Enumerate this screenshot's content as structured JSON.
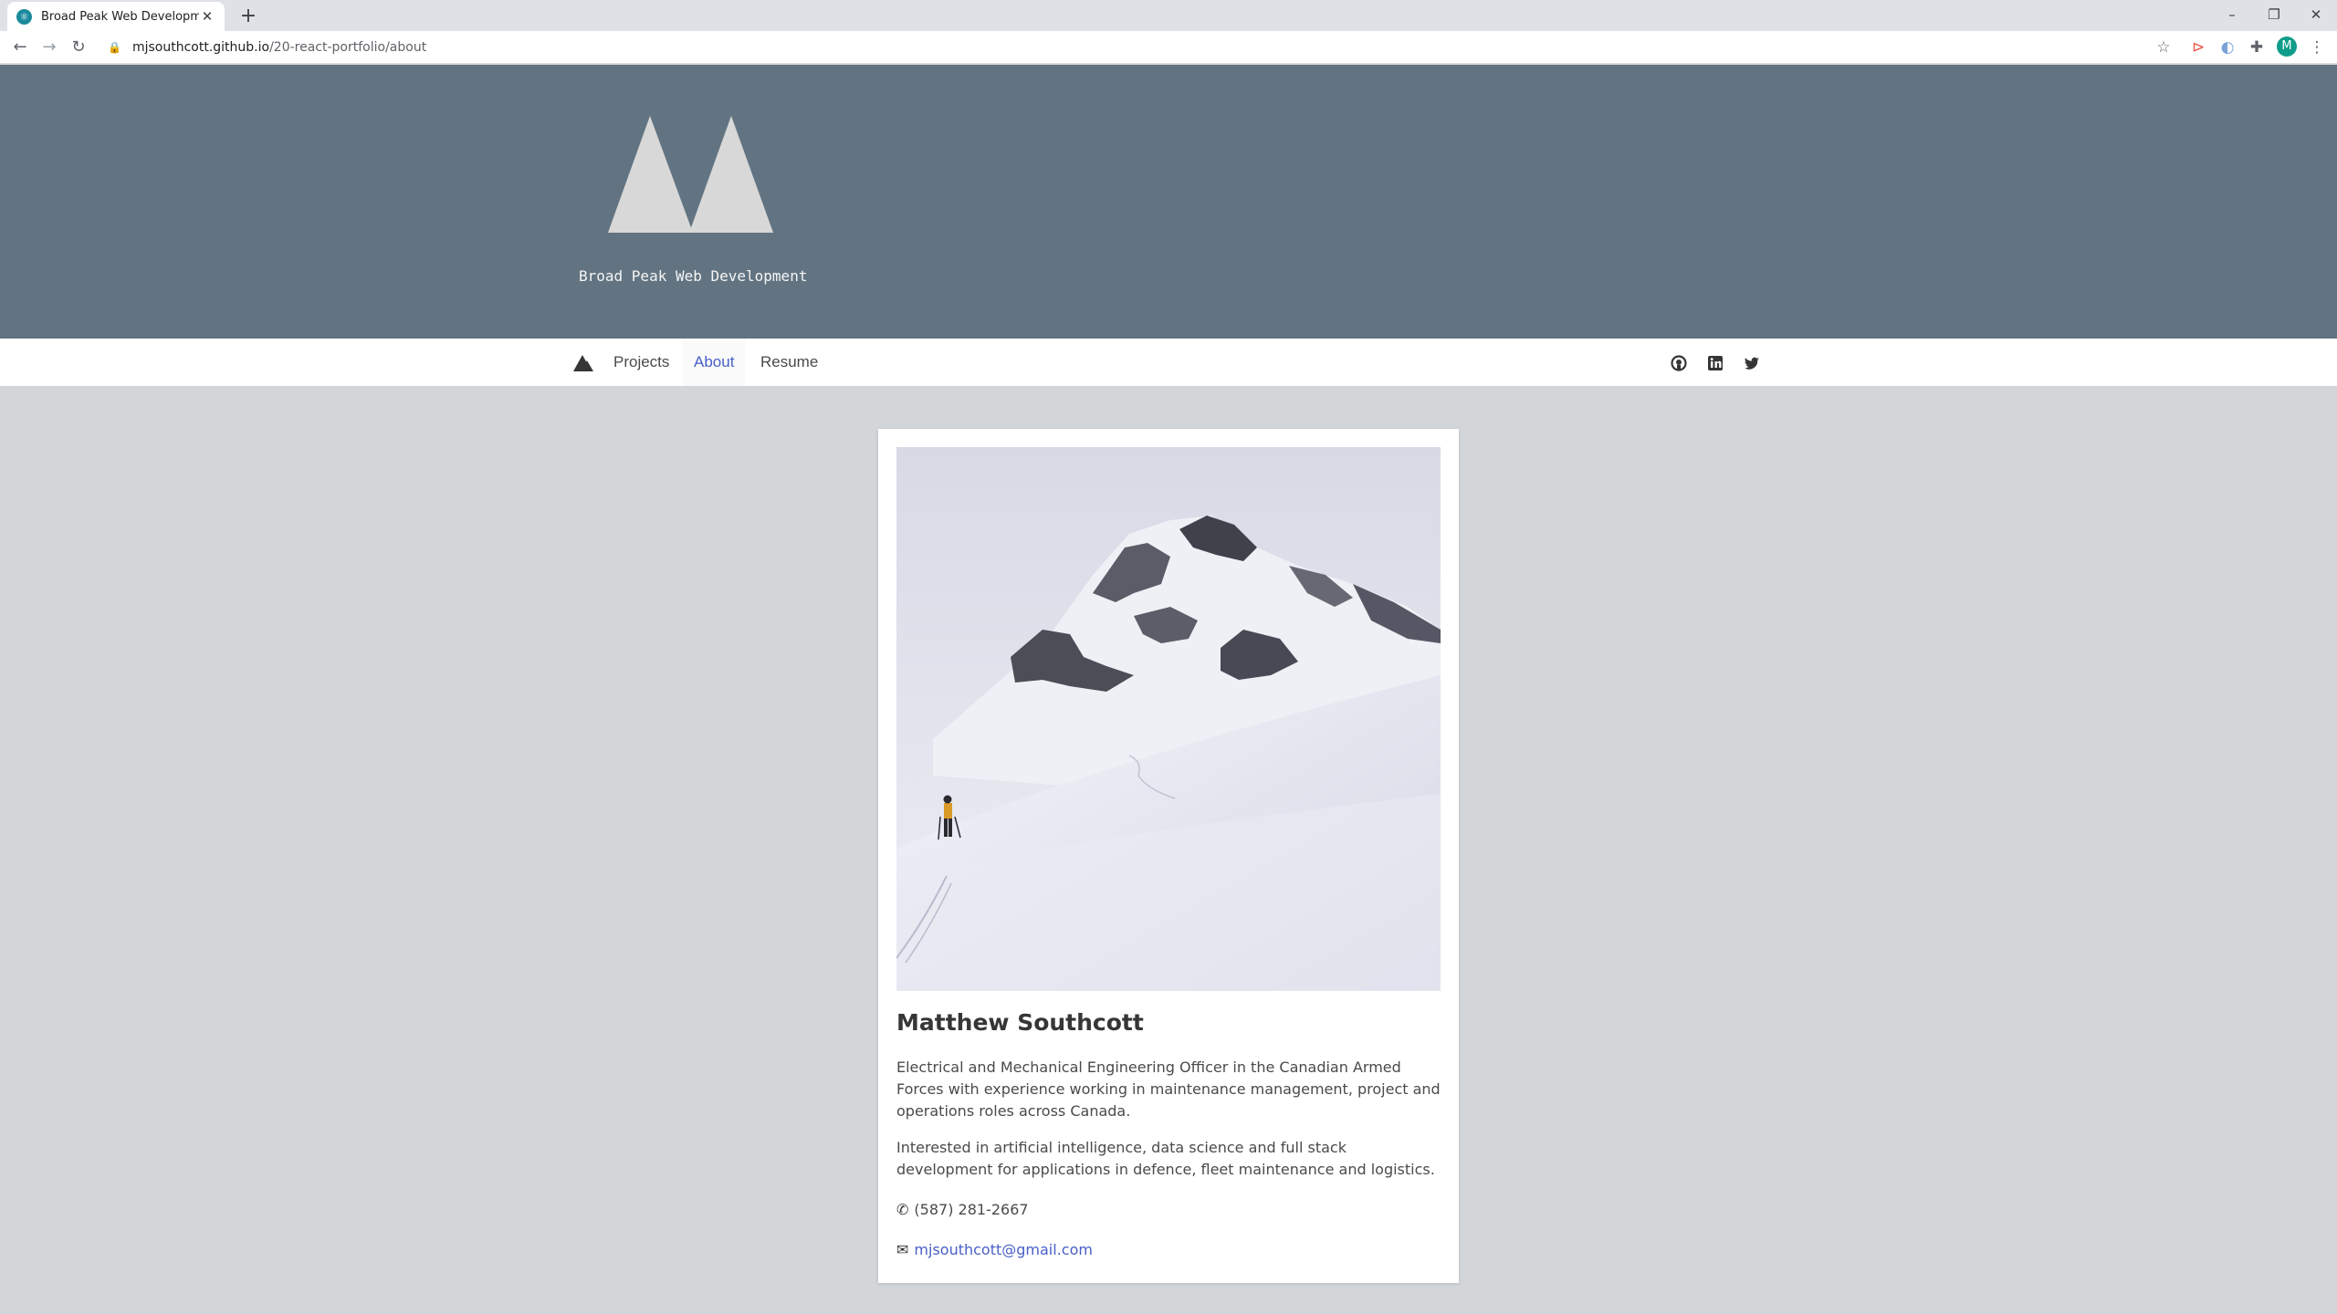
{
  "browser": {
    "tab_title": "Broad Peak Web Development",
    "tab_close": "✕",
    "new_tab": "+",
    "url_host": "mjsouthcott.github.io",
    "url_path": "/20-react-portfolio/about",
    "profile_initial": "M"
  },
  "header": {
    "brand_name": "Broad Peak Web Development"
  },
  "nav": {
    "items": [
      {
        "label": "Projects"
      },
      {
        "label": "About"
      },
      {
        "label": "Resume"
      }
    ],
    "active": "About",
    "social": [
      "github-icon",
      "linkedin-icon",
      "twitter-icon"
    ]
  },
  "profile": {
    "name": "Matthew Southcott",
    "bio_1": "Electrical and Mechanical Engineering Officer in the Canadian Armed Forces with experience working in maintenance management, project and operations roles across Canada.",
    "bio_2": "Interested in artificial intelligence, data science and full stack development for applications in defence, fleet maintenance and logistics.",
    "phone": "(587) 281-2667",
    "email": "mjsouthcott@gmail.com"
  },
  "colors": {
    "hero_bg": "#627482",
    "page_bg": "#d3d6d9",
    "link": "#485fc7"
  }
}
